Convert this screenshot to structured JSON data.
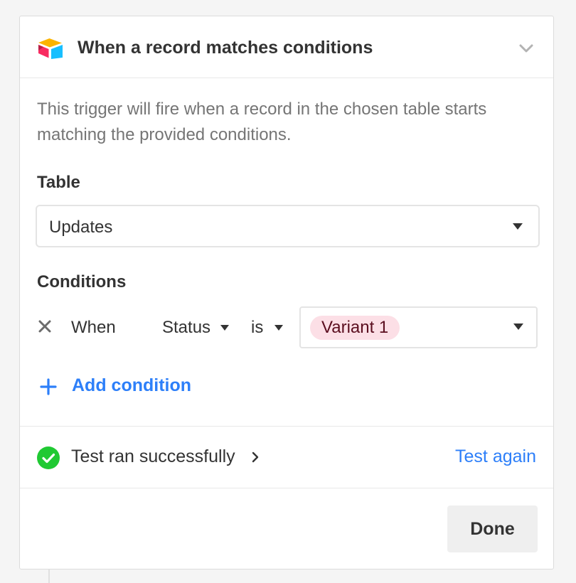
{
  "header": {
    "title": "When a record matches conditions",
    "logo_icon": "airtable-logo",
    "toggle_icon": "chevron-down-icon"
  },
  "description": "This trigger will fire when a record in the chosen table starts matching the provided conditions.",
  "table": {
    "label": "Table",
    "selected": "Updates"
  },
  "conditions": {
    "label": "Conditions",
    "rows": [
      {
        "prefix": "When",
        "field": "Status",
        "operator": "is",
        "value": "Variant 1"
      }
    ],
    "add_label": "Add condition"
  },
  "test": {
    "status": "Test ran successfully",
    "again_label": "Test again"
  },
  "done_label": "Done",
  "colors": {
    "accent": "#2d7ff9",
    "success": "#20c933",
    "pill_bg": "#fcdfe6",
    "pill_text": "#5b0e1f"
  }
}
